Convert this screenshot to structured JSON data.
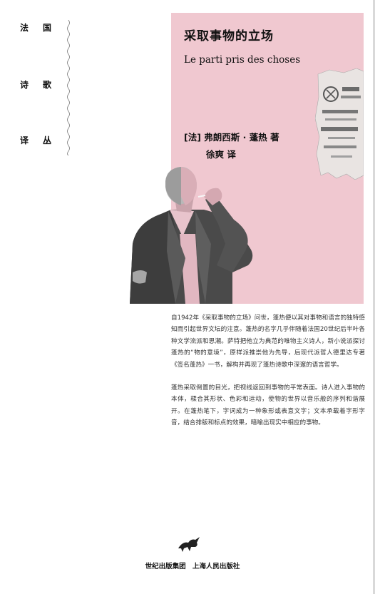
{
  "series": {
    "rows": [
      {
        "left": "法",
        "right": "国"
      },
      {
        "left": "诗",
        "right": "歌"
      },
      {
        "left": "译",
        "right": "丛"
      }
    ]
  },
  "book": {
    "title_zh": "采取事物的立场",
    "title_fr": "Le parti pris des choses",
    "author_line": "[法]  弗朗西斯 · 蓬热  著",
    "translator_line": "徐爽  译"
  },
  "description": {
    "paragraphs": [
      "自1942年《采取事物的立场》问世，蓬热便以其对事物和语言的独特感知而引起世界文坛的注意。蓬热的名字几乎伴随着法国20世纪后半叶各种文学流派和思潮。萨特把他立为典范的唯物主义诗人，新小说派探讨蓬热的“物的意境”，原样派推崇他为先导，后现代派哲人德里达专著《签名蓬热》一书，解构并再现了蓬热诗歌中深邃的语言哲学。",
      "蓬热采取倒置的目光，把视线返回到事物的平常表面。诗人进入事物的本体，糅合其形状、色彩和运动，使物的世界以音乐般的序列和谐展开。在蓬热笔下，字词成为一种象形或表意文字；文本承载着字形字音，结合排版和标点的效果，暗喻出现实中相应的事物。"
    ]
  },
  "publisher": {
    "group": "世纪出版集团",
    "house": "上海人民出版社"
  },
  "colors": {
    "accent_pink": "#f0c8d0"
  }
}
